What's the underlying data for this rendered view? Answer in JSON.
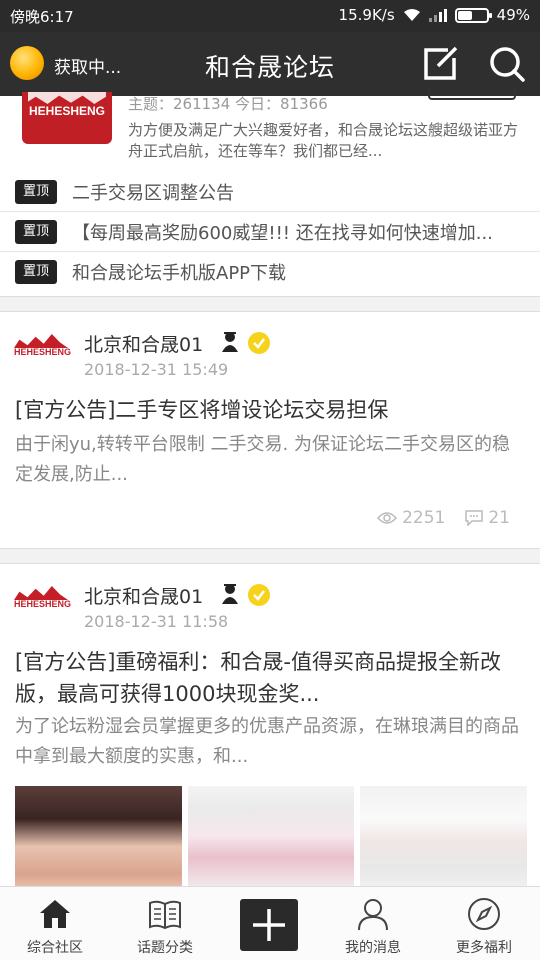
{
  "status_bar": {
    "time": "傍晚6:17",
    "speed": "15.9K/s",
    "battery": "49%",
    "battery_level": 0.49
  },
  "header": {
    "loading_text": "获取中...",
    "title": "和合晟论坛"
  },
  "forum": {
    "logo_text": "HEHESHENG",
    "stats": "主题：261134  今日：81366",
    "description": "为方便及满足广大兴趣爱好者，和合晟论坛这艘超级诺亚方舟正式启航，还在等车？我们都已经..."
  },
  "pinned": [
    {
      "badge": "置顶",
      "text": "二手交易区调整公告"
    },
    {
      "badge": "置顶",
      "text": "【每周最高奖励600威望!!! 还在找寻如何快速增加..."
    },
    {
      "badge": "置顶",
      "text": "和合晟论坛手机版APP下载"
    }
  ],
  "posts": [
    {
      "avatar_text": "HEHESHENG",
      "author": "北京和合晟01",
      "date": "2018-12-31 15:49",
      "title": "[官方公告]二手专区将增设论坛交易担保",
      "summary": "由于闲yu,转转平台限制  二手交易.  为保证论坛二手交易区的稳定发展,防止...",
      "views": "2251",
      "comments": "21"
    },
    {
      "avatar_text": "HEHESHENG",
      "author": "北京和合晟01",
      "date": "2018-12-31 11:58",
      "title": "[官方公告]重磅福利：和合晟-值得买商品提报全新改版，最高可获得1000块现金奖...",
      "summary": "为了论坛粉湿会员掌握更多的优惠产品资源，在琳琅满目的商品中拿到最大额度的实惠，和..."
    }
  ],
  "bottom_nav": [
    {
      "label": "综合社区",
      "icon": "home-icon"
    },
    {
      "label": "话题分类",
      "icon": "book-icon"
    },
    {
      "label": "我的消息",
      "icon": "person-icon"
    },
    {
      "label": "更多福利",
      "icon": "compass-icon"
    }
  ],
  "colors": {
    "header_bg": "#2f2f2f",
    "brand_red": "#c01f25",
    "verified_yellow": "#f7d21a"
  }
}
